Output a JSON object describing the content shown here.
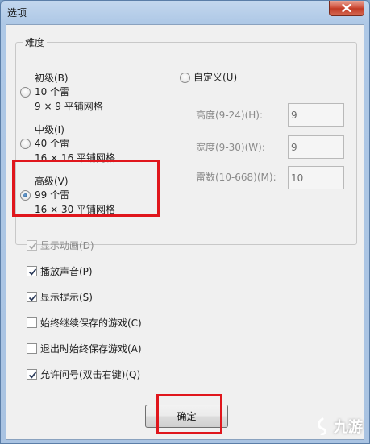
{
  "window": {
    "title": "选项"
  },
  "difficulty": {
    "group_label": "难度",
    "beginner": {
      "label": "初级(B)",
      "mines": "10 个雷",
      "grid": "9 × 9 平铺网格",
      "selected": false
    },
    "intermediate": {
      "label": "中级(I)",
      "mines": "40 个雷",
      "grid": "16 × 16 平铺网格",
      "selected": false
    },
    "advanced": {
      "label": "高级(V)",
      "mines": "99 个雷",
      "grid": "16 × 30 平铺网格",
      "selected": true
    },
    "custom": {
      "label": "自定义(U)",
      "selected": false,
      "height_label": "高度(9-24)(H):",
      "height_value": "9",
      "width_label": "宽度(9-30)(W):",
      "width_value": "9",
      "mines_label": "雷数(10-668)(M):",
      "mines_value": "10"
    }
  },
  "options": [
    {
      "label": "显示动画(D)",
      "checked": true,
      "disabled": true
    },
    {
      "label": "播放声音(P)",
      "checked": true,
      "disabled": false
    },
    {
      "label": "显示提示(S)",
      "checked": true,
      "disabled": false
    },
    {
      "label": "始终继续保存的游戏(C)",
      "checked": false,
      "disabled": false
    },
    {
      "label": "退出时始终保存游戏(A)",
      "checked": false,
      "disabled": false
    },
    {
      "label": "允许问号(双击右键)(Q)",
      "checked": true,
      "disabled": false
    }
  ],
  "ok_button": {
    "label": "确定"
  },
  "watermark": {
    "text": "九游"
  },
  "colors": {
    "highlight": "#e0161c",
    "disabled_text": "#8a8a8a"
  }
}
